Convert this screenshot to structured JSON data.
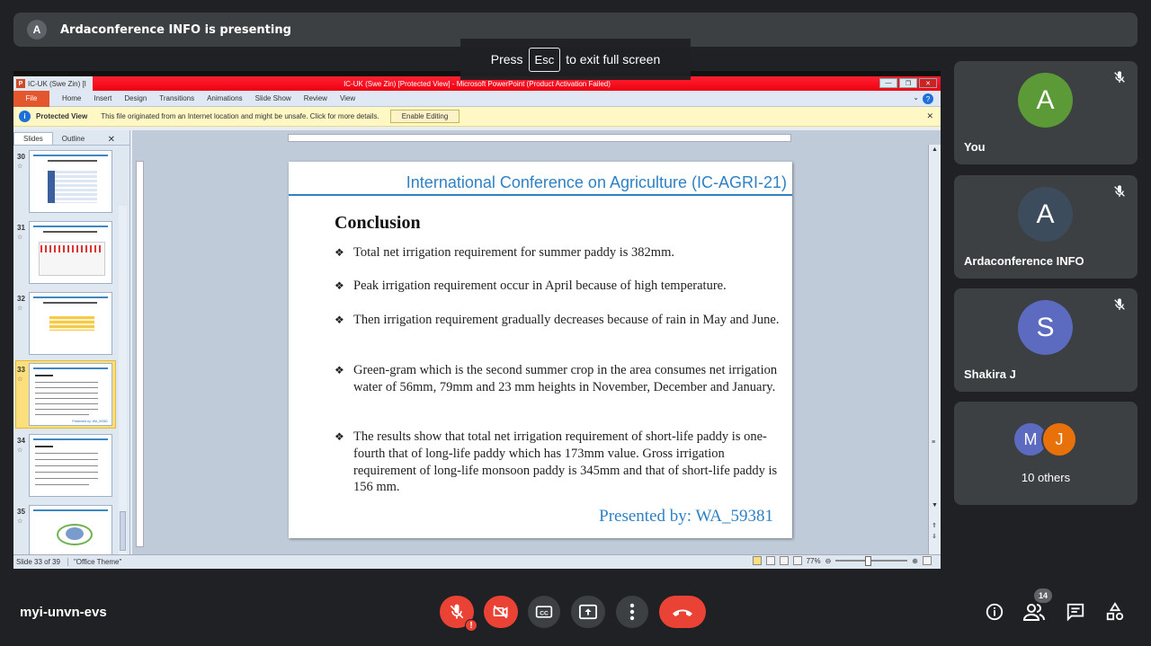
{
  "presenter": {
    "avatar_letter": "A",
    "text": "Ardaconference INFO is presenting"
  },
  "esc_toast": {
    "before": "Press",
    "key": "Esc",
    "after": "to exit full screen"
  },
  "ppt": {
    "tab_label": "IC-UK (Swe Zin) [I",
    "window_title": "IC-UK (Swe Zin) [Protected View] - Microsoft PowerPoint (Product Activation Failed)",
    "ribbon_tabs": [
      "Home",
      "Insert",
      "Design",
      "Transitions",
      "Animations",
      "Slide Show",
      "Review",
      "View"
    ],
    "file_tab": "File",
    "protected": {
      "label": "Protected View",
      "message": "This file originated from an Internet location and might be unsafe. Click for more details.",
      "button": "Enable Editing"
    },
    "pane_tabs": {
      "slides": "Slides",
      "outline": "Outline"
    },
    "thumbnails": [
      {
        "num": "30"
      },
      {
        "num": "31"
      },
      {
        "num": "32"
      },
      {
        "num": "33"
      },
      {
        "num": "34"
      },
      {
        "num": "35"
      }
    ],
    "status": {
      "slide": "Slide 33 of 39",
      "theme": "\"Office Theme\"",
      "zoom": "77%"
    }
  },
  "slide": {
    "header": "International Conference on Agriculture (IC-AGRI-21)",
    "heading": "Conclusion",
    "bullets": [
      "Total net irrigation requirement for summer paddy is 382mm.",
      "Peak irrigation requirement occur in April because of high temperature.",
      "Then irrigation requirement gradually decreases because of rain in May and June.",
      "Green-gram which is the second summer crop in the area consumes net irrigation water of 56mm, 79mm and 23 mm heights in November, December and January.",
      "The results show that total net irrigation requirement of short-life paddy is one-fourth that of long-life paddy  which has 173mm value. Gross irrigation requirement of long-life monsoon paddy is 345mm and that of short-life paddy is 156 mm."
    ],
    "presenter": "Presented by:   WA_59381"
  },
  "participants": [
    {
      "letter": "A",
      "name": "You",
      "color": "#5b9a37"
    },
    {
      "letter": "A",
      "name": "Ardaconference INFO",
      "color": "#3c4c5c"
    },
    {
      "letter": "S",
      "name": "Shakira J",
      "color": "#5c6bc0"
    }
  ],
  "others": {
    "letters": [
      "M",
      "J"
    ],
    "colors": [
      "#5c6bc0",
      "#e8710a"
    ],
    "label": "10 others"
  },
  "meeting_code": "myi-unvn-evs",
  "people_count": "14",
  "colors": {
    "accent_red": "#ea4335",
    "slide_blue": "#2f81c4"
  }
}
